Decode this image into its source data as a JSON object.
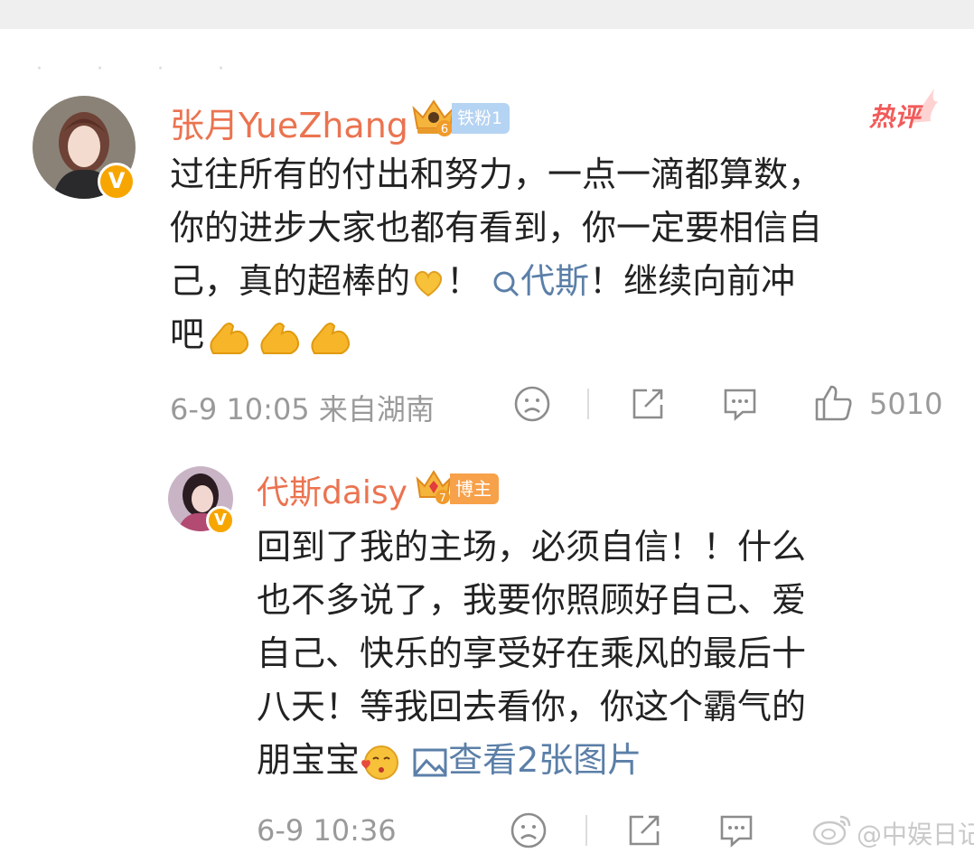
{
  "colors": {
    "username": "#eb7350",
    "link": "#5b7fa8",
    "meta": "#9a9a9a",
    "hot": "#f25a5a",
    "vip": "#f7a600"
  },
  "comment1": {
    "username": "张月YueZhang",
    "crown_level": "6",
    "fan_badge": "铁粉1",
    "hot_label": "热评",
    "text_lines": [
      "过往所有的付出和努力，一点一滴都算数，",
      "你的进步大家也都有看到，你一定要相信自",
      "己，真的超棒的"
    ],
    "text_after_emoji": "！",
    "mention": "代斯",
    "text_after_mention": "！继续向前冲",
    "text_last_line": "吧",
    "time": "6-9 10:05",
    "location": "来自湖南",
    "like_count": "5010"
  },
  "reply": {
    "username": "代斯daisy",
    "crown_level": "7",
    "host_badge": "博主",
    "text_lines": [
      "回到了我的主场，必须自信！！什么",
      "也不多说了，我要你照顾好自己、爱",
      "自己、快乐的享受好在乘风的最后十",
      "八天！等我回去看你，你这个霸气的"
    ],
    "text_last_line": "朋宝宝",
    "view_images_link": "查看2张图片",
    "time": "6-9 10:36"
  },
  "watermark": "@中娱日记",
  "icons": [
    "verified-icon",
    "crown-icon",
    "emoji-heart-hands-icon",
    "search-icon",
    "emoji-muscle-icon",
    "dislike-face-icon",
    "share-icon",
    "comment-icon",
    "like-icon",
    "emoji-kiss-icon",
    "image-icon"
  ]
}
